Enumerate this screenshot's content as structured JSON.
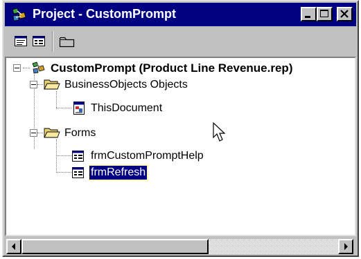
{
  "window": {
    "title": "Project - CustomPrompt",
    "title_icon": "project-explorer-icon",
    "controls": [
      "minimize-icon",
      "maximize-icon",
      "close-icon"
    ]
  },
  "toolbar": {
    "buttons": [
      "view-code-icon",
      "view-object-icon",
      "toggle-folders-icon"
    ]
  },
  "tree": {
    "root": {
      "label": "CustomPrompt (Product Line Revenue.rep)",
      "icon": "businessobjects-project-icon"
    },
    "folders": [
      {
        "label": "BusinessObjects Objects",
        "icon": "folder-open-icon",
        "children": [
          {
            "label": "ThisDocument",
            "icon": "document-icon"
          }
        ]
      },
      {
        "label": "Forms",
        "icon": "folder-open-icon",
        "children": [
          {
            "label": "frmCustomPromptHelp",
            "icon": "form-icon"
          },
          {
            "label": "frmRefresh",
            "icon": "form-icon",
            "selected": true
          }
        ]
      }
    ]
  },
  "scrollbar": {
    "position": 0.0
  },
  "colors": {
    "titlebar": "#000080",
    "face": "#c0c0c0",
    "selection": "#000080"
  }
}
